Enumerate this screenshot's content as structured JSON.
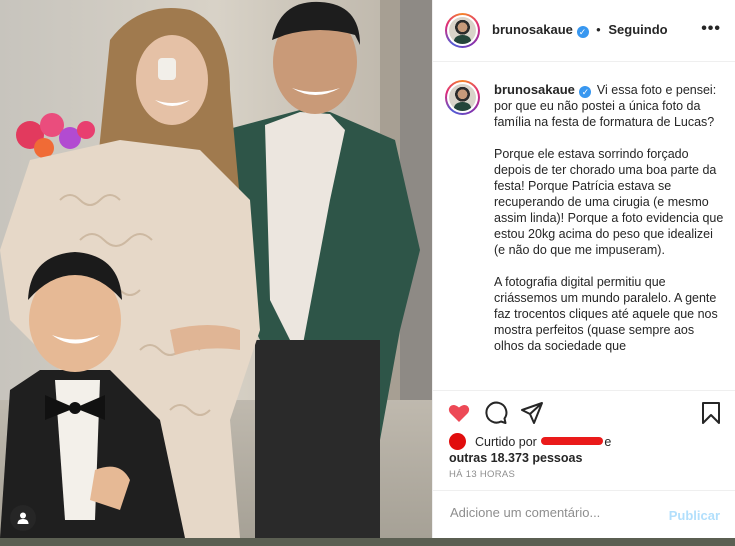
{
  "post": {
    "username": "brunosakaue",
    "verified_icon": "verified-badge-icon",
    "follow_status": "Seguindo",
    "more_icon": "more-options-icon",
    "caption_paragraphs": [
      "Vi essa foto e pensei: por que eu não postei a única foto da família na festa de formatura de Lucas?",
      "Porque ele estava sorrindo forçado depois de ter chorado uma boa parte da festa! Porque Patrícia estava se recuperando de uma cirugia (e mesmo assim linda)! Porque a foto evidencia que estou 20kg acima do peso que idealizei (e não do que me impuseram).",
      "A fotografia digital permitiu que criássemos um mundo paralelo. A gente faz trocentos cliques até aquele que nos mostra perfeitos (quase sempre aos olhos da sociedade que"
    ],
    "likes": {
      "prefix": "Curtido por",
      "joiner": "e",
      "others": "outras 18.373 pessoas"
    },
    "timestamp": "HÁ 13 HORAS"
  },
  "comment_box": {
    "placeholder": "Adicione um comentário...",
    "publish_label": "Publicar"
  },
  "colors": {
    "like_red": "#ed4956",
    "verified_blue": "#3897f0",
    "publish_disabled": "#b2dffc"
  }
}
